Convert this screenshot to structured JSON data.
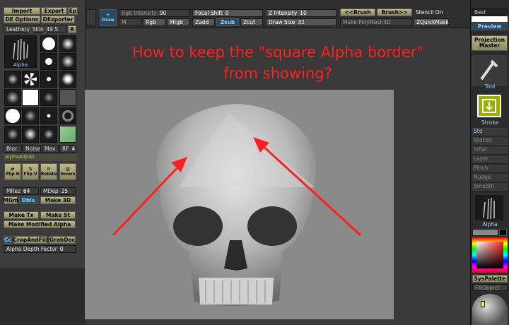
{
  "left": {
    "import": "Import",
    "export": "Export",
    "ep": "Ep",
    "de_options": "DE Options",
    "dexporter": "DExporter",
    "alpha_name": "Leathery_Skin_49.5",
    "alpha_r": "R",
    "alpha_label": "Alpha",
    "blur": "Blur",
    "noise": "Noise",
    "max": "Max",
    "rf": "RF",
    "rf_val": "4",
    "alpha_adjust": "AlphaAdjust",
    "flip_h": "Flip H",
    "flip_v": "Flip V",
    "rotate": "Rotate",
    "invers": "Invers",
    "mrez": "MRez",
    "mrez_val": "64",
    "mdep": "MDep",
    "mdep_val": "25",
    "mgm": "MGm",
    "dbls": "Dbls",
    "make3d": "Make 3D",
    "make_tx": "Make Tx",
    "make_st": "Make St",
    "make_modified_alpha": "Make Modified Alpha",
    "cc": "Cc",
    "crop_and_fill": "CropAndFill",
    "grab_doc": "GrabDoc",
    "alpha_depth_factor": "Alpha Depth Factor",
    "alpha_depth_val": "0"
  },
  "top": {
    "draw": "Draw",
    "rgb_intensity": "Rgb Intensity",
    "rgb_intensity_val": "90",
    "focal_shift": "Focal Shift",
    "focal_shift_val": "0",
    "z_intensity": "Z Intensity",
    "z_intensity_val": "10",
    "prev_brush": "<<Brush",
    "next_brush": "Brush>>",
    "stencil_on": "Stencil On",
    "m": "M",
    "rgb": "Rgb",
    "mrgb": "Mrgb",
    "zadd": "Zadd",
    "zsub": "Zsub",
    "zcut": "Zcut",
    "draw_size": "Draw Size",
    "draw_size_val": "32",
    "make_polymesh": "Make PolyMesh3D",
    "zquickmask": "ZQuickMask"
  },
  "right": {
    "best": "Best",
    "preview": "Preview",
    "projection_master": "Projection Master",
    "tool": "Tool",
    "stroke": "Stroke",
    "std": "Std",
    "stddot": "StdDot",
    "inflat": "Inflat",
    "layer": "Layer",
    "pinch": "Pinch",
    "nudge": "Nudge",
    "smooth": "Smooth",
    "alpha": "Alpha",
    "syspalette": "SysPalette",
    "fillobject": "FillObject"
  },
  "headline": {
    "line1": "How to keep the \"square Alpha border\"",
    "line2": "from showing?"
  },
  "colors": {
    "accent": "#ff2020",
    "button": "#bdb98a",
    "highlight": "#8fd0ff"
  },
  "icons": [
    "flip-h-icon",
    "flip-v-icon",
    "rotate-icon",
    "invers-icon",
    "tool-icon",
    "stroke-icon",
    "alpha-brush-icon",
    "cursor-icon"
  ]
}
